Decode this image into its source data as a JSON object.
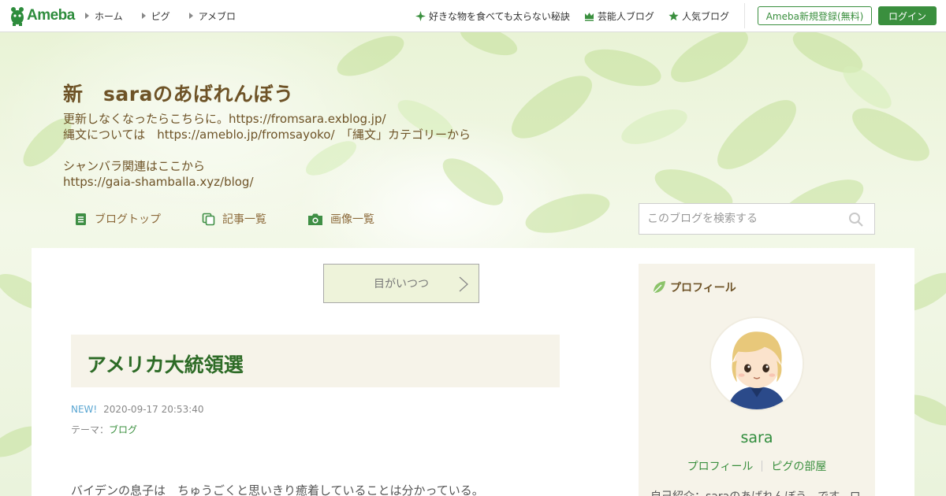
{
  "header": {
    "logo": "Ameba",
    "nav": [
      "ホーム",
      "ピグ",
      "アメブロ"
    ],
    "links": [
      {
        "label": "好きな物を食べても太らない秘訣",
        "icon": "sparkle-icon"
      },
      {
        "label": "芸能人ブログ",
        "icon": "crown-icon"
      },
      {
        "label": "人気ブログ",
        "icon": "star-icon"
      }
    ],
    "register_label": "Ameba新規登録(無料)",
    "login_label": "ログイン"
  },
  "blog": {
    "title": "新　saraのあばれんぼう",
    "description": [
      "更新しなくなったらこちらに。https://fromsara.exblog.jp/",
      "縄文については　https://ameblo.jp/fromsayoko/　「縄文」カテゴリーから",
      "",
      "シャンバラ関連はここから",
      "https://gaia-shamballa.xyz/blog/"
    ],
    "nav": [
      {
        "label": "ブログトップ",
        "icon": "document-icon"
      },
      {
        "label": "記事一覧",
        "icon": "copy-icon"
      },
      {
        "label": "画像一覧",
        "icon": "camera-icon"
      }
    ],
    "search_placeholder": "このブログを検索する"
  },
  "entry": {
    "prev_link": "目がいつつ",
    "title": "アメリカ大統領選",
    "new_badge": "NEW!",
    "datetime": "2020-09-17 20:53:40",
    "theme_label": "テーマ：",
    "theme": "ブログ",
    "body_first_line": "バイデンの息子は　ちゅうごくと思いきり癒着していることは分かっている。"
  },
  "profile": {
    "heading": "プロフィール",
    "name": "sara",
    "links": [
      "プロフィール",
      "ピグの部屋"
    ],
    "intro": "自己紹介：saraのあばれんぼう　です。ロ"
  },
  "colors": {
    "brand_green": "#3a8f3e",
    "title_brown": "#6e5327",
    "entry_title_green": "#2d6b26",
    "new_blue": "#5aa6d2"
  }
}
